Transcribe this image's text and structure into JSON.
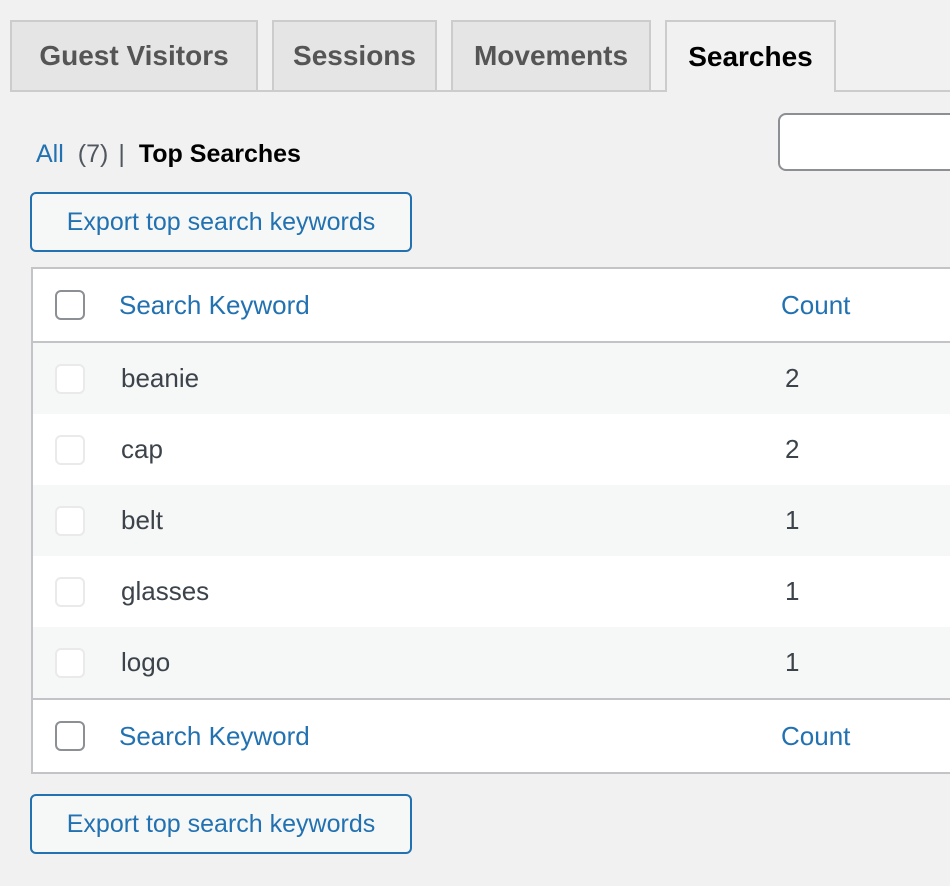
{
  "tabs": [
    {
      "label": "Guest Visitors",
      "active": false
    },
    {
      "label": "Sessions",
      "active": false
    },
    {
      "label": "Movements",
      "active": false
    },
    {
      "label": "Searches",
      "active": true
    }
  ],
  "filters": {
    "all_label": "All",
    "all_count": "(7)",
    "separator": "|",
    "current_label": "Top Searches"
  },
  "export_button_label": "Export top search keywords",
  "table": {
    "columns": {
      "keyword": "Search Keyword",
      "count": "Count"
    },
    "rows": [
      {
        "keyword": "beanie",
        "count": "2"
      },
      {
        "keyword": "cap",
        "count": "2"
      },
      {
        "keyword": "belt",
        "count": "1"
      },
      {
        "keyword": "glasses",
        "count": "1"
      },
      {
        "keyword": "logo",
        "count": "1"
      }
    ]
  },
  "colors": {
    "link": "#2271b1",
    "background": "#f1f1f1",
    "border": "#c3c4c7"
  }
}
